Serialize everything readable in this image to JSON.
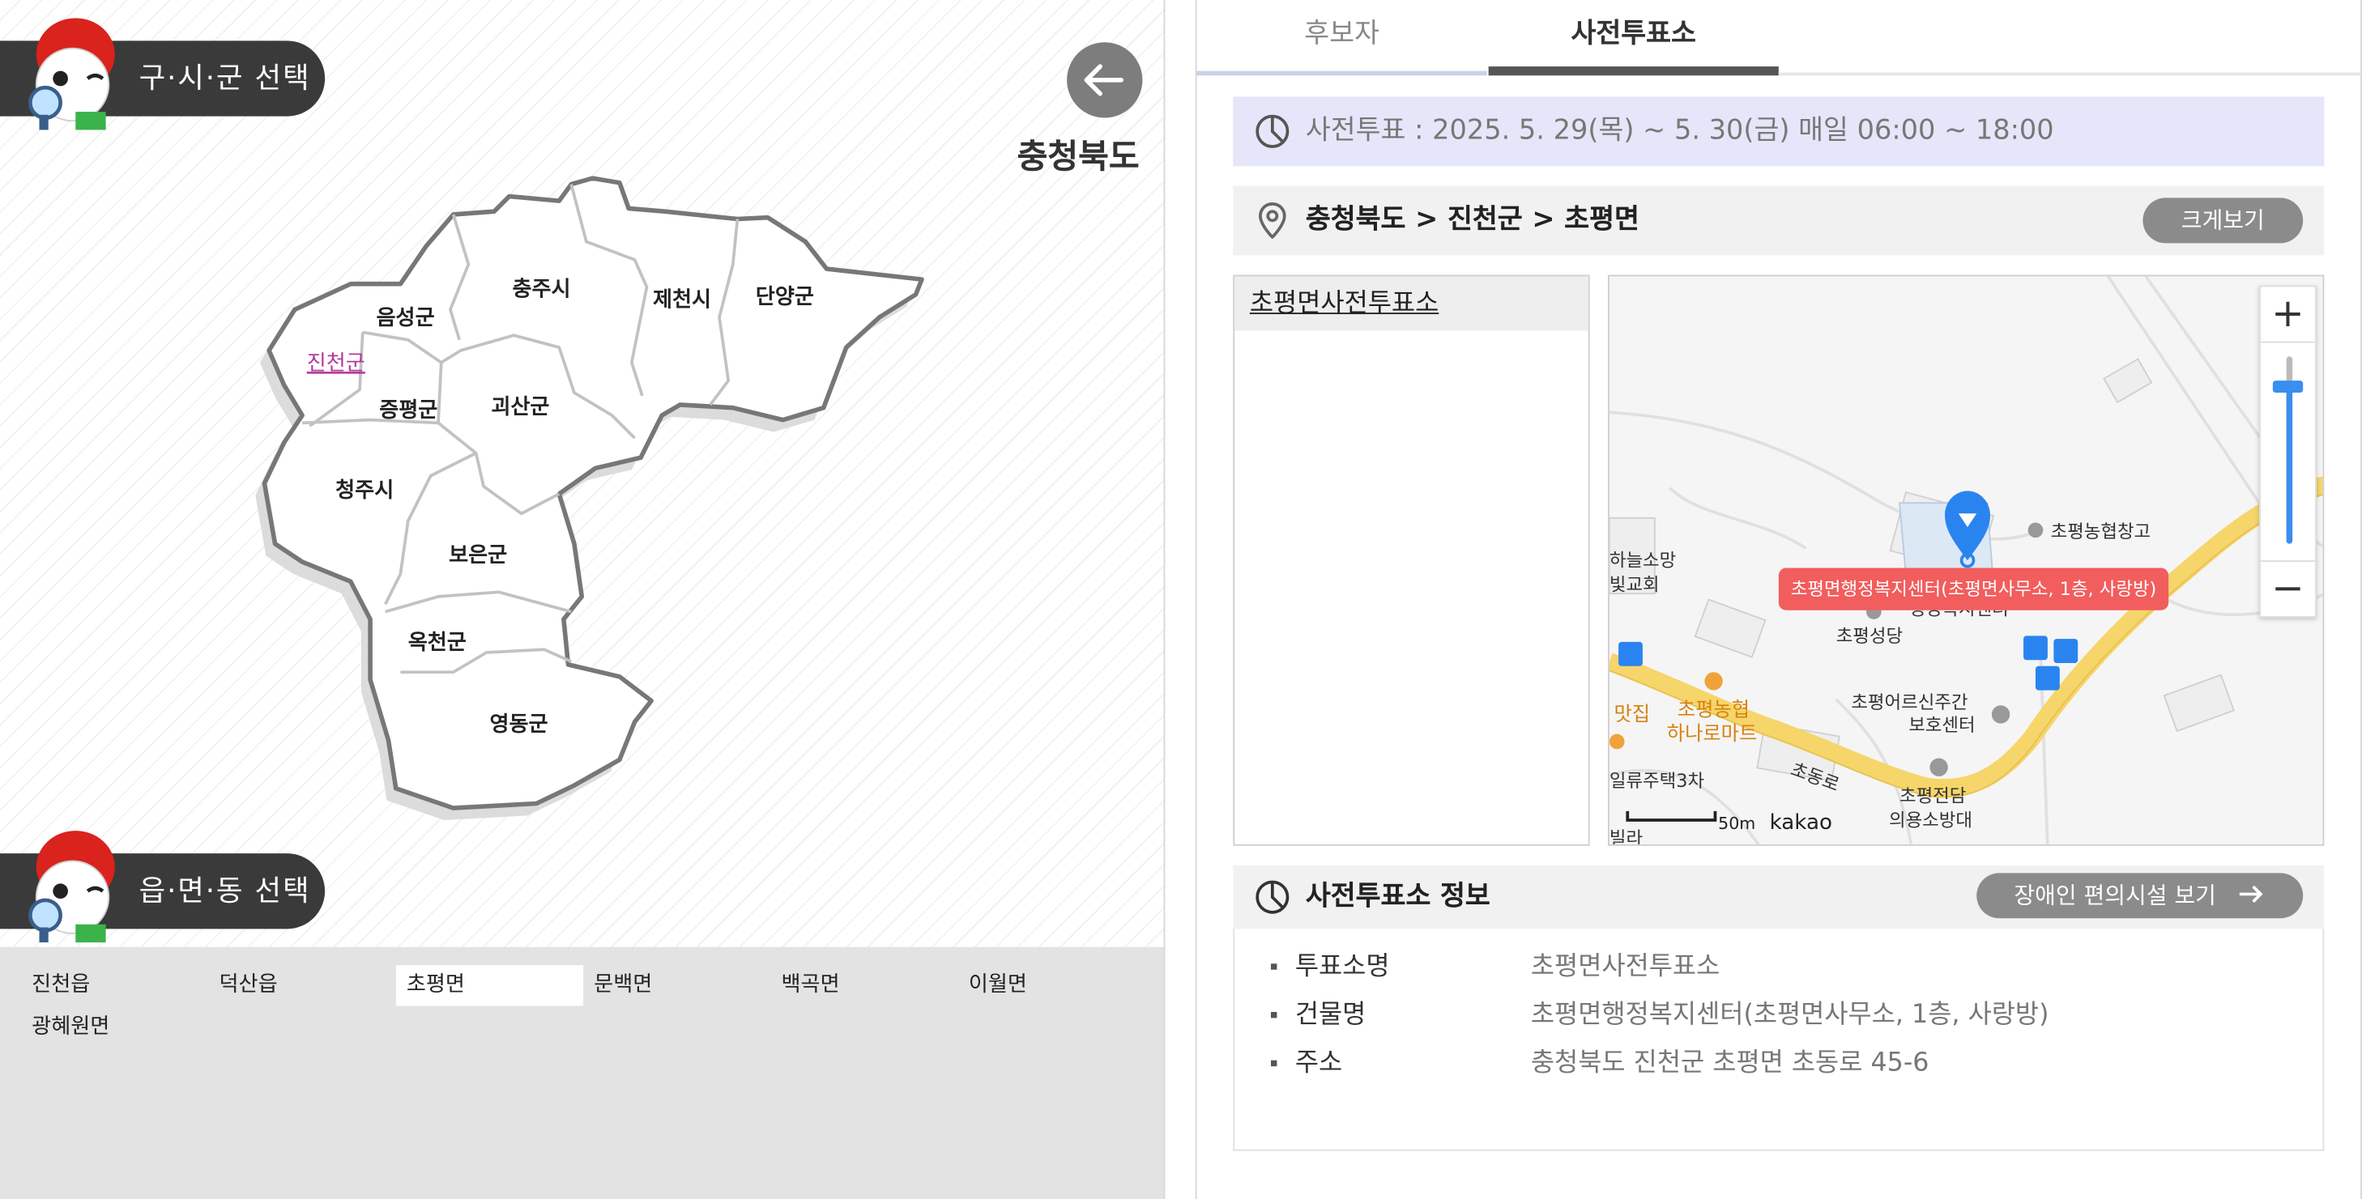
{
  "left_panel": {
    "district_section_title": "구·시·군 선택",
    "town_section_title": "읍·면·동 선택",
    "province_title": "충청북도",
    "districts": [
      {
        "name": "충주시",
        "selected": false
      },
      {
        "name": "제천시",
        "selected": false
      },
      {
        "name": "단양군",
        "selected": false
      },
      {
        "name": "음성군",
        "selected": false
      },
      {
        "name": "진천군",
        "selected": true
      },
      {
        "name": "증평군",
        "selected": false
      },
      {
        "name": "괴산군",
        "selected": false
      },
      {
        "name": "청주시",
        "selected": false
      },
      {
        "name": "보은군",
        "selected": false
      },
      {
        "name": "옥천군",
        "selected": false
      },
      {
        "name": "영동군",
        "selected": false
      }
    ],
    "towns": [
      "진천읍",
      "덕산읍",
      "초평면",
      "문백면",
      "백곡면",
      "이월면",
      "광혜원면"
    ],
    "selected_town": "초평면"
  },
  "tabs": [
    {
      "label": "후보자",
      "active": false
    },
    {
      "label": "사전투표소",
      "active": true
    }
  ],
  "period_text": "사전투표 : 2025. 5. 29(목) ~ 5. 30(금) 매일 06:00 ~ 18:00",
  "location": {
    "breadcrumb": "충청북도 > 진천군 > 초평면",
    "enlarge_button": "크게보기"
  },
  "station_list": [
    "초평면사전투표소"
  ],
  "map": {
    "pin_tooltip": "초평면행정복지센터(초평면사무소, 1층, 사랑방)",
    "labels": {
      "warehouse": "초평농협창고",
      "church1": "하늘소망",
      "church2": "빛교회",
      "cathedral": "초평성당",
      "senior1": "초평어르신주간",
      "senior2": "보호센터",
      "mart1": "초평농협",
      "mart2": "하나로마트",
      "restaurant": "맛집",
      "housing": "일류주택3차",
      "road": "초동로",
      "fire1": "초평전담",
      "fire2": "의용소방대",
      "villa": "빌라",
      "behind_tooltip": "행정복지센터"
    },
    "scale": "50m",
    "brand": "kakao",
    "zoom_in": "+",
    "zoom_out": "−"
  },
  "info": {
    "title": "사전투표소 정보",
    "access_button": "장애인 편의시설 보기",
    "rows": [
      {
        "key": "투표소명",
        "value": "초평면사전투표소"
      },
      {
        "key": "건물명",
        "value": "초평면행정복지센터(초평면사무소, 1층, 사랑방)"
      },
      {
        "key": "주소",
        "value": "충청북도 진천군 초평면 초동로 45-6"
      }
    ]
  },
  "colors": {
    "selected_district": "#b33a9a",
    "map_pin": "#2a84f0",
    "tooltip_bg": "#f25d5d",
    "road": "#f6d56a",
    "period_bg": "#e6e6fa"
  }
}
